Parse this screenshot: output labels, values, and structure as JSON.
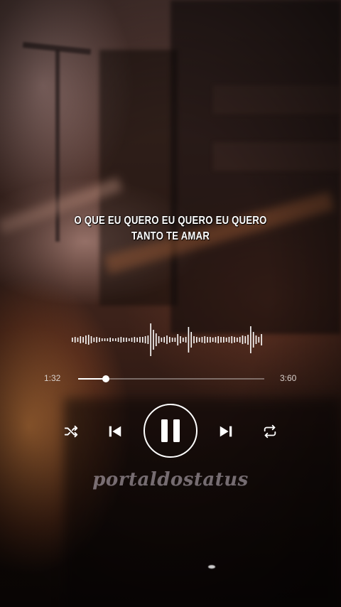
{
  "lyrics": {
    "line1": "O QUE EU QUERO EU QUERO EU QUERO",
    "line2": "TANTO TE AMAR"
  },
  "player": {
    "current_time": "1:32",
    "total_time": "3:60",
    "progress_fraction": 0.15,
    "state": "playing",
    "waveform_heights": [
      6,
      8,
      6,
      10,
      8,
      12,
      14,
      10,
      6,
      8,
      6,
      4,
      4,
      4,
      6,
      4,
      4,
      6,
      8,
      6,
      6,
      4,
      6,
      8,
      6,
      8,
      8,
      10,
      12,
      46,
      28,
      18,
      10,
      6,
      8,
      12,
      8,
      6,
      6,
      16,
      10,
      6,
      8,
      36,
      22,
      10,
      8,
      6,
      8,
      10,
      8,
      8,
      6,
      8,
      10,
      8,
      8,
      6,
      8,
      10,
      8,
      6,
      8,
      12,
      10,
      14,
      38,
      22,
      12,
      8,
      16
    ]
  },
  "controls": {
    "shuffle_icon": "shuffle-icon",
    "prev_icon": "skip-previous-icon",
    "play_icon": "pause-icon",
    "next_icon": "skip-next-icon",
    "repeat_icon": "repeat-icon"
  },
  "watermark": "portaldostatus",
  "colors": {
    "foreground": "#ffffff",
    "track": "#8a7f7c"
  }
}
